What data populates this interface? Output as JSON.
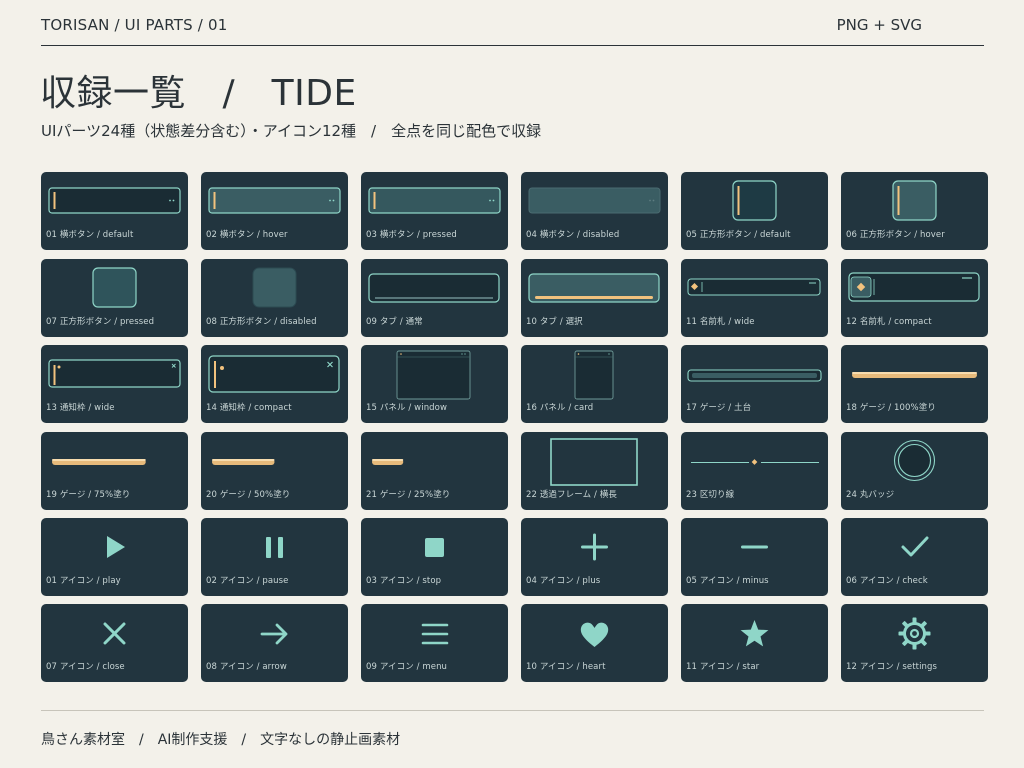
{
  "header": {
    "breadcrumb": "TORISAN / UI PARTS / 01",
    "format": "PNG + SVG"
  },
  "title": "収録一覧　/　TIDE",
  "subtitle": "UIパーツ24種（状態差分含む）・アイコン12種　/　全点を同じ配色で収録",
  "footer": "鳥さん素材室　/　AI制作支援　/　文字なしの静止画素材",
  "colors": {
    "background": "#f3f1ea",
    "card": "#22353f",
    "accent_mint": "#8fd6c8",
    "accent_gold": "#f2c27e",
    "fill_teal": "#3a5d63",
    "fill_dark": "#1a2c34"
  },
  "parts": [
    {
      "label": "01 横ボタン / default",
      "icon": "horizontal-button-default"
    },
    {
      "label": "02 横ボタン / hover",
      "icon": "horizontal-button-hover"
    },
    {
      "label": "03 横ボタン / pressed",
      "icon": "horizontal-button-pressed"
    },
    {
      "label": "04 横ボタン / disabled",
      "icon": "horizontal-button-disabled"
    },
    {
      "label": "05 正方形ボタン / default",
      "icon": "square-button-default"
    },
    {
      "label": "06 正方形ボタン / hover",
      "icon": "square-button-hover"
    },
    {
      "label": "07 正方形ボタン / pressed",
      "icon": "square-button-pressed"
    },
    {
      "label": "08 正方形ボタン / disabled",
      "icon": "square-button-disabled"
    },
    {
      "label": "09 タブ / 通常",
      "icon": "tab-normal"
    },
    {
      "label": "10 タブ / 選択",
      "icon": "tab-selected"
    },
    {
      "label": "11 名前札 / wide",
      "icon": "nameplate-wide"
    },
    {
      "label": "12 名前札 / compact",
      "icon": "nameplate-compact"
    },
    {
      "label": "13 通知枠 / wide",
      "icon": "notification-wide"
    },
    {
      "label": "14 通知枠 / compact",
      "icon": "notification-compact"
    },
    {
      "label": "15 パネル / window",
      "icon": "panel-window"
    },
    {
      "label": "16 パネル / card",
      "icon": "panel-card"
    },
    {
      "label": "17 ゲージ / 土台",
      "icon": "gauge-base"
    },
    {
      "label": "18 ゲージ / 100%塗り",
      "icon": "gauge-100",
      "fill": 1.0
    },
    {
      "label": "19 ゲージ / 75%塗り",
      "icon": "gauge-75",
      "fill": 0.75
    },
    {
      "label": "20 ゲージ / 50%塗り",
      "icon": "gauge-50",
      "fill": 0.5
    },
    {
      "label": "21 ゲージ / 25%塗り",
      "icon": "gauge-25",
      "fill": 0.25
    },
    {
      "label": "22 透過フレーム / 横長",
      "icon": "transparent-frame"
    },
    {
      "label": "23 区切り線",
      "icon": "divider-line"
    },
    {
      "label": "24 丸バッジ",
      "icon": "round-badge"
    }
  ],
  "icons": [
    {
      "label": "01 アイコン / play",
      "icon": "play-icon"
    },
    {
      "label": "02 アイコン / pause",
      "icon": "pause-icon"
    },
    {
      "label": "03 アイコン / stop",
      "icon": "stop-icon"
    },
    {
      "label": "04 アイコン / plus",
      "icon": "plus-icon"
    },
    {
      "label": "05 アイコン / minus",
      "icon": "minus-icon"
    },
    {
      "label": "06 アイコン / check",
      "icon": "check-icon"
    },
    {
      "label": "07 アイコン / close",
      "icon": "close-icon"
    },
    {
      "label": "08 アイコン / arrow",
      "icon": "arrow-icon"
    },
    {
      "label": "09 アイコン / menu",
      "icon": "menu-icon"
    },
    {
      "label": "10 アイコン / heart",
      "icon": "heart-icon"
    },
    {
      "label": "11 アイコン / star",
      "icon": "star-icon"
    },
    {
      "label": "12 アイコン / settings",
      "icon": "settings-icon"
    }
  ]
}
